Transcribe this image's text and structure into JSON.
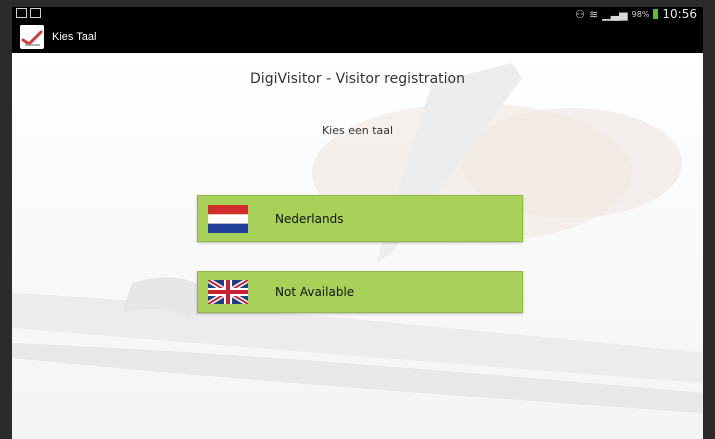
{
  "status_bar": {
    "battery_percent": "98%",
    "time": "10:56"
  },
  "action_bar": {
    "title": "Kies Taal",
    "icon": "pen-checkmark-app-icon"
  },
  "main": {
    "heading": "DigiVisitor - Visitor registration",
    "subheading": "Kies een taal",
    "languages": [
      {
        "label": "Nederlands",
        "flag": "netherlands-flag-icon"
      },
      {
        "label": "Not Available",
        "flag": "uk-flag-icon"
      }
    ]
  },
  "colors": {
    "button_bg": "#a8d15a",
    "action_bar_bg": "#000000",
    "battery": "#5fbf2a"
  }
}
